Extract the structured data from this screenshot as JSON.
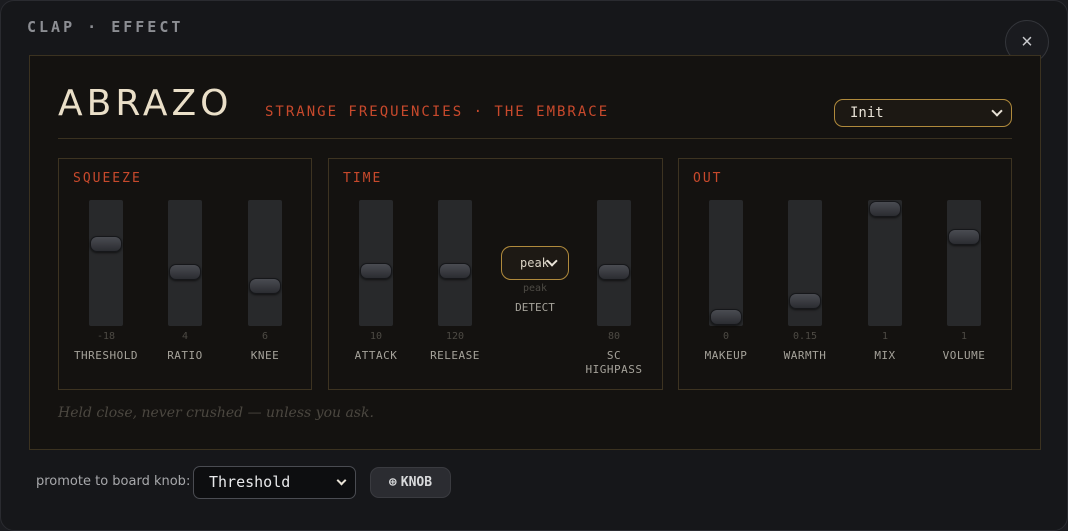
{
  "window": {
    "title": "CLAP · EFFECT",
    "close_glyph": "×"
  },
  "plugin": {
    "name": "ABRAZO",
    "subtitle": "STRANGE FREQUENCIES · THE EMBRACE",
    "preset": "Init",
    "tagline": "Held close, never crushed — unless you ask.",
    "accent_color": "#c8492c",
    "gold_color": "#b08a3c"
  },
  "sections": {
    "squeeze": {
      "title": "SQUEEZE",
      "faders": [
        {
          "label": "THRESHOLD",
          "value": "-18",
          "level": 0.68
        },
        {
          "label": "RATIO",
          "value": "4",
          "level": 0.42
        },
        {
          "label": "KNEE",
          "value": "6",
          "level": 0.29
        }
      ]
    },
    "time": {
      "title": "TIME",
      "faders": [
        {
          "label": "ATTACK",
          "value": "10",
          "level": 0.43
        },
        {
          "label": "RELEASE",
          "value": "120",
          "level": 0.43
        },
        {
          "label": "SC HIGHPASS",
          "value": "80",
          "level": 0.42
        }
      ],
      "detect": {
        "selected": "peak",
        "label": "DETECT"
      }
    },
    "out": {
      "title": "OUT",
      "faders": [
        {
          "label": "MAKEUP",
          "value": "0",
          "level": 0.0
        },
        {
          "label": "WARMTH",
          "value": "0.15",
          "level": 0.15
        },
        {
          "label": "MIX",
          "value": "1",
          "level": 1.0
        },
        {
          "label": "VOLUME",
          "value": "1",
          "level": 0.74
        }
      ]
    }
  },
  "footer": {
    "promote_label": "promote to board knob:",
    "promote_selected": "Threshold",
    "knob_button": "KNOB",
    "knob_icon": "⊕"
  }
}
